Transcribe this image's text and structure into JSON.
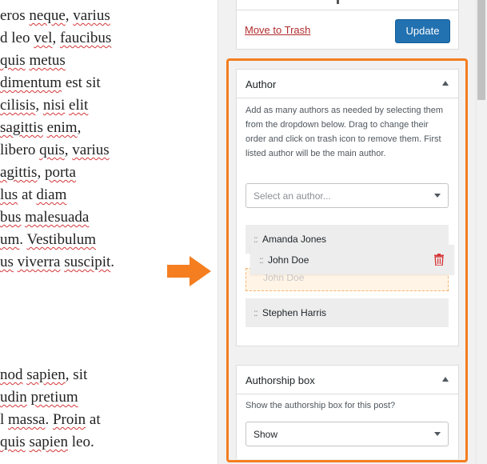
{
  "editor": {
    "lines": [
      [
        "eros ",
        {
          "sp": "neque"
        },
        ", ",
        {
          "sp": "varius"
        }
      ],
      [
        "d leo ",
        {
          "sp": "vel"
        },
        ", ",
        {
          "sp": "faucibus"
        }
      ],
      [
        " ",
        {
          "sp": "quis"
        },
        " ",
        {
          "sp": "metus"
        }
      ],
      [
        {
          "sp": "dimentum"
        },
        " est sit"
      ],
      [
        {
          "sp": "cilisis"
        },
        ", ",
        {
          "sp": "nisi"
        },
        " ",
        {
          "sp": "elit"
        }
      ],
      [
        " ",
        {
          "sp": "sagittis"
        },
        " ",
        {
          "sp": "enim"
        },
        ","
      ],
      [
        " libero ",
        {
          "sp": "quis"
        },
        ", ",
        {
          "sp": "varius"
        }
      ],
      [
        {
          "sp": "agittis"
        },
        ", ",
        {
          "sp": "porta"
        }
      ],
      [
        {
          "sp": "lus"
        },
        " at ",
        {
          "sp": "diam"
        }
      ],
      [
        {
          "sp": "bus"
        },
        " ",
        {
          "sp": "malesuada"
        }
      ],
      [
        {
          "sp": "um"
        },
        ". ",
        {
          "sp": "Vestibulum"
        }
      ],
      [
        {
          "sp": "us"
        },
        " ",
        {
          "sp": "viverra"
        },
        " ",
        {
          "sp": "suscipit"
        },
        "."
      ],
      [
        {
          "sp": "nod"
        },
        " ",
        {
          "sp": "sapien"
        },
        ", sit"
      ],
      [
        {
          "sp": "udin"
        },
        " ",
        {
          "sp": "pretium"
        }
      ],
      [
        "l ",
        {
          "sp": "massa"
        },
        ". ",
        {
          "sp": "Proin"
        },
        " at"
      ],
      [
        " ",
        {
          "sp": "quis"
        },
        " ",
        {
          "sp": "sapien"
        },
        " leo."
      ]
    ]
  },
  "publish": {
    "move_to_trash": "Move to Trash",
    "update": "Update"
  },
  "author_panel": {
    "title": "Author",
    "description": "Add as many authors as needed by selecting them from the dropdown below. Drag to change their order and click on trash icon to remove them. First listed author will be the main author.",
    "select_placeholder": "Select an author...",
    "authors": [
      "Amanda Jones",
      "John Doe",
      "Stephen Harris"
    ],
    "dragging": "John Doe",
    "placeholder": "John Doe",
    "handle": "::"
  },
  "box_panel": {
    "title": "Authorship box",
    "question": "Show the authorship box for this post?",
    "selected": "Show"
  },
  "colors": {
    "highlight": "#f47e20",
    "arrow": "#f47e20",
    "update_button": "#2271b1",
    "trash_link": "#b32d2e",
    "trash_icon": "#d63638"
  },
  "icons": [
    "move-handle-icon",
    "trash-icon",
    "chevron-up-icon",
    "chevron-down-icon",
    "arrow-right-icon"
  ]
}
